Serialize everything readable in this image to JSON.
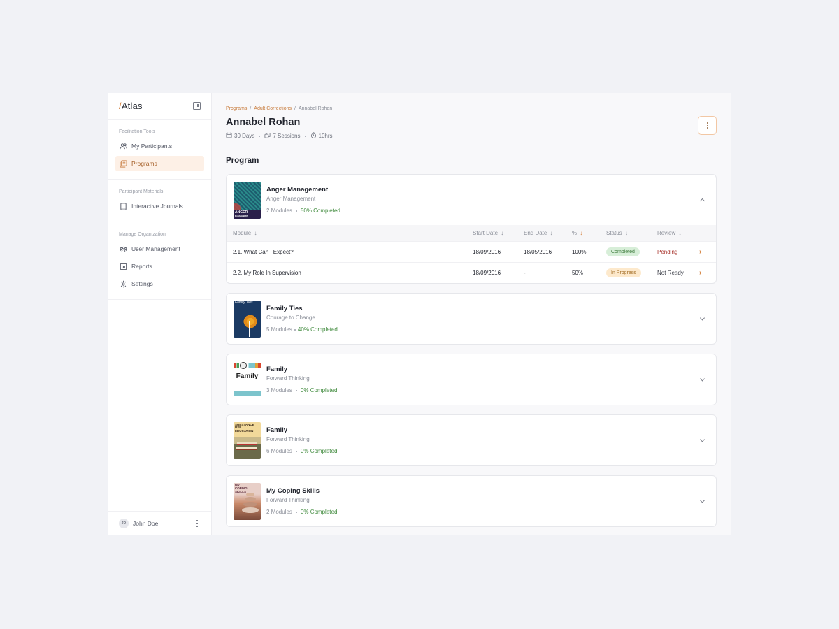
{
  "app": {
    "name": "Atlas"
  },
  "sidebar": {
    "sections": [
      {
        "title": "Facilitation Tools",
        "items": [
          {
            "label": "My Participants",
            "icon": "users-icon",
            "active": false
          },
          {
            "label": "Programs",
            "icon": "programs-icon",
            "active": true
          }
        ]
      },
      {
        "title": "Participant Materials",
        "items": [
          {
            "label": "Interactive Journals",
            "icon": "journal-icon",
            "active": false
          }
        ]
      },
      {
        "title": "Manage Organization",
        "items": [
          {
            "label": "User Management",
            "icon": "user-group-icon",
            "active": false
          },
          {
            "label": "Reports",
            "icon": "reports-icon",
            "active": false
          },
          {
            "label": "Settings",
            "icon": "gear-icon",
            "active": false
          }
        ]
      }
    ],
    "user": {
      "initials": "JD",
      "name": "John Doe"
    }
  },
  "breadcrumb": [
    {
      "label": "Programs",
      "link": true
    },
    {
      "label": "Adult Corrections",
      "link": true
    },
    {
      "label": "Annabel Rohan",
      "link": false
    }
  ],
  "breadcrumb_sep": "/",
  "header": {
    "title": "Annabel Rohan",
    "meta": {
      "days": "30 Days",
      "sessions": "7 Sessions",
      "hours": "10hrs"
    }
  },
  "program_heading": "Program",
  "colors": {
    "accent": "#d4813e",
    "success": "#3f8a3c",
    "danger": "#a8332c"
  },
  "programs": [
    {
      "title": "Anger Management",
      "subtitle": "Anger Management",
      "modules": "2 Modules",
      "completed": "50% Completed",
      "expanded": true,
      "table": {
        "headers": [
          "Module",
          "Start Date",
          "End Date",
          "%",
          "Status",
          "Review"
        ],
        "sort_arrow": "↓",
        "rows": [
          {
            "module": "2.1. What Can I Expect?",
            "start": "18/09/2016",
            "end": "18/05/2016",
            "pct": "100%",
            "status": "Completed",
            "review": "Pending"
          },
          {
            "module": "2.2. My Role In Supervision",
            "start": "18/09/2016",
            "end": "-",
            "pct": "50%",
            "status": "In Progress",
            "review": "Not Ready"
          }
        ]
      }
    },
    {
      "title": "Family Ties",
      "subtitle": "Courage to Change",
      "modules": "5 Modules",
      "completed": "40% Completed",
      "expanded": false
    },
    {
      "title": "Family",
      "subtitle": "Forward Thinking",
      "modules": "3 Modules",
      "completed": "0% Completed",
      "expanded": false
    },
    {
      "title": "Family",
      "subtitle": "Forward Thinking",
      "modules": "6 Modules",
      "completed": "0% Completed",
      "expanded": false
    },
    {
      "title": "My Coping Skills",
      "subtitle": "Forward Thinking",
      "modules": "2 Modules",
      "completed": "0% Completed",
      "expanded": false
    }
  ],
  "covers": {
    "anger": {
      "text": "ANGER",
      "sub": "MANAGEMENT"
    },
    "familyties": {
      "text": "Family Ties"
    },
    "family": {
      "text": "Family"
    },
    "substance": {
      "text": "SUBSTANCE USE EDUCATION"
    },
    "coping": {
      "text": "MY COPING SKILLS"
    }
  }
}
